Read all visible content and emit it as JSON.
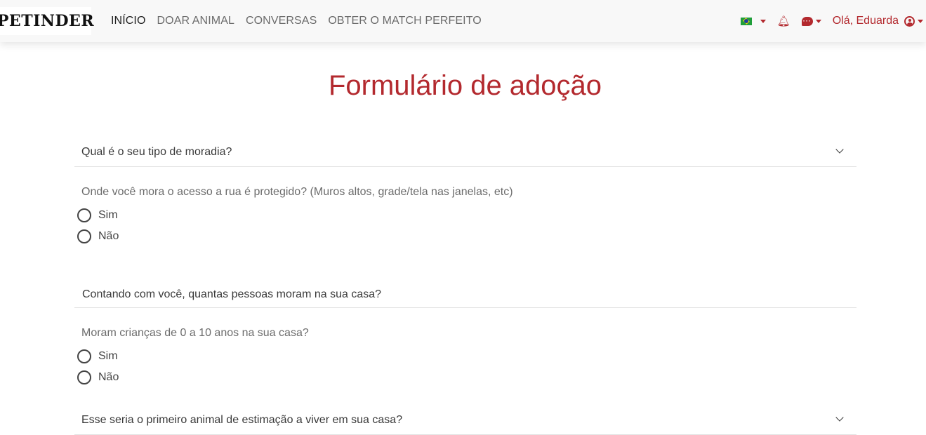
{
  "navbar": {
    "logo_text": "PETINDER",
    "links": [
      "INÍCIO",
      "DOAR ANIMAL",
      "CONVERSAS",
      "OBTER O MATCH PERFEITO"
    ],
    "greeting": "Olá, Eduarda",
    "icons": [
      "brazil-flag-icon",
      "bell-icon",
      "chat-icon",
      "user-circle-icon"
    ]
  },
  "form": {
    "title": "Formulário de adoção",
    "housing_question": "Qual é o seu tipo de moradia?",
    "protected_question": "Onde você mora o acesso a rua é protegido? (Muros altos, grade/tela nas janelas, etc)",
    "protected_options": [
      "Sim",
      "Não"
    ],
    "people_question": "Contando com você, quantas pessoas moram na sua casa?",
    "children_question": "Moram crianças de 0 a 10 anos na sua casa?",
    "children_options": [
      "Sim",
      "Não"
    ],
    "first_pet_question": "Esse seria o primeiro animal de estimação a viver em sua casa?"
  },
  "colors": {
    "accent": "#b3292e",
    "navbar_bg": "#f8f8f8",
    "divider": "#e2e2e2"
  }
}
